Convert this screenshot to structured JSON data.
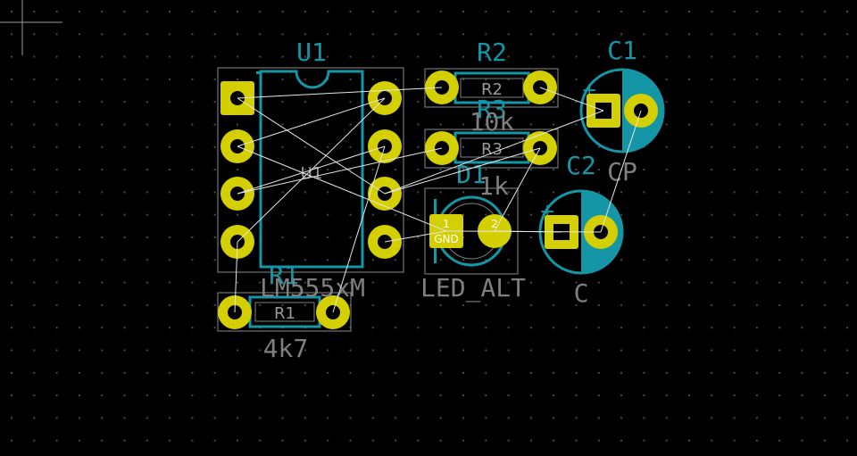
{
  "editor": "PCB layout canvas",
  "colors": {
    "background": "#000000",
    "grid_dot": "#4a4a4a",
    "copper_pad": "#d4cf00",
    "silkscreen": "#1596a6",
    "fab_text": "#7f7f7f",
    "courtyard": "#8a8a8a",
    "ratsnest": "#e6e6e6",
    "capacitor_fill": "#1596a6"
  },
  "cursor": {
    "icon": "crosshair-cursor-icon"
  },
  "components": {
    "u1": {
      "ref": "U1",
      "fab_ref": "U1",
      "value": "LM555xM"
    },
    "r1": {
      "ref": "R1",
      "fab_ref": "R1",
      "value": "4k7"
    },
    "r2": {
      "ref": "R2",
      "fab_ref": "R2",
      "value": "10k"
    },
    "r3": {
      "ref": "R3",
      "fab_ref": "R3",
      "value": "1k"
    },
    "d1": {
      "ref": "D1",
      "value": "LED_ALT",
      "pin1_number": "1",
      "pin1_net": "GND",
      "pin2_number": "2"
    },
    "c1": {
      "ref": "C1",
      "value": "CP",
      "polarity": "+"
    },
    "c2": {
      "ref": "C2",
      "value": "C",
      "polarity": "+"
    }
  }
}
